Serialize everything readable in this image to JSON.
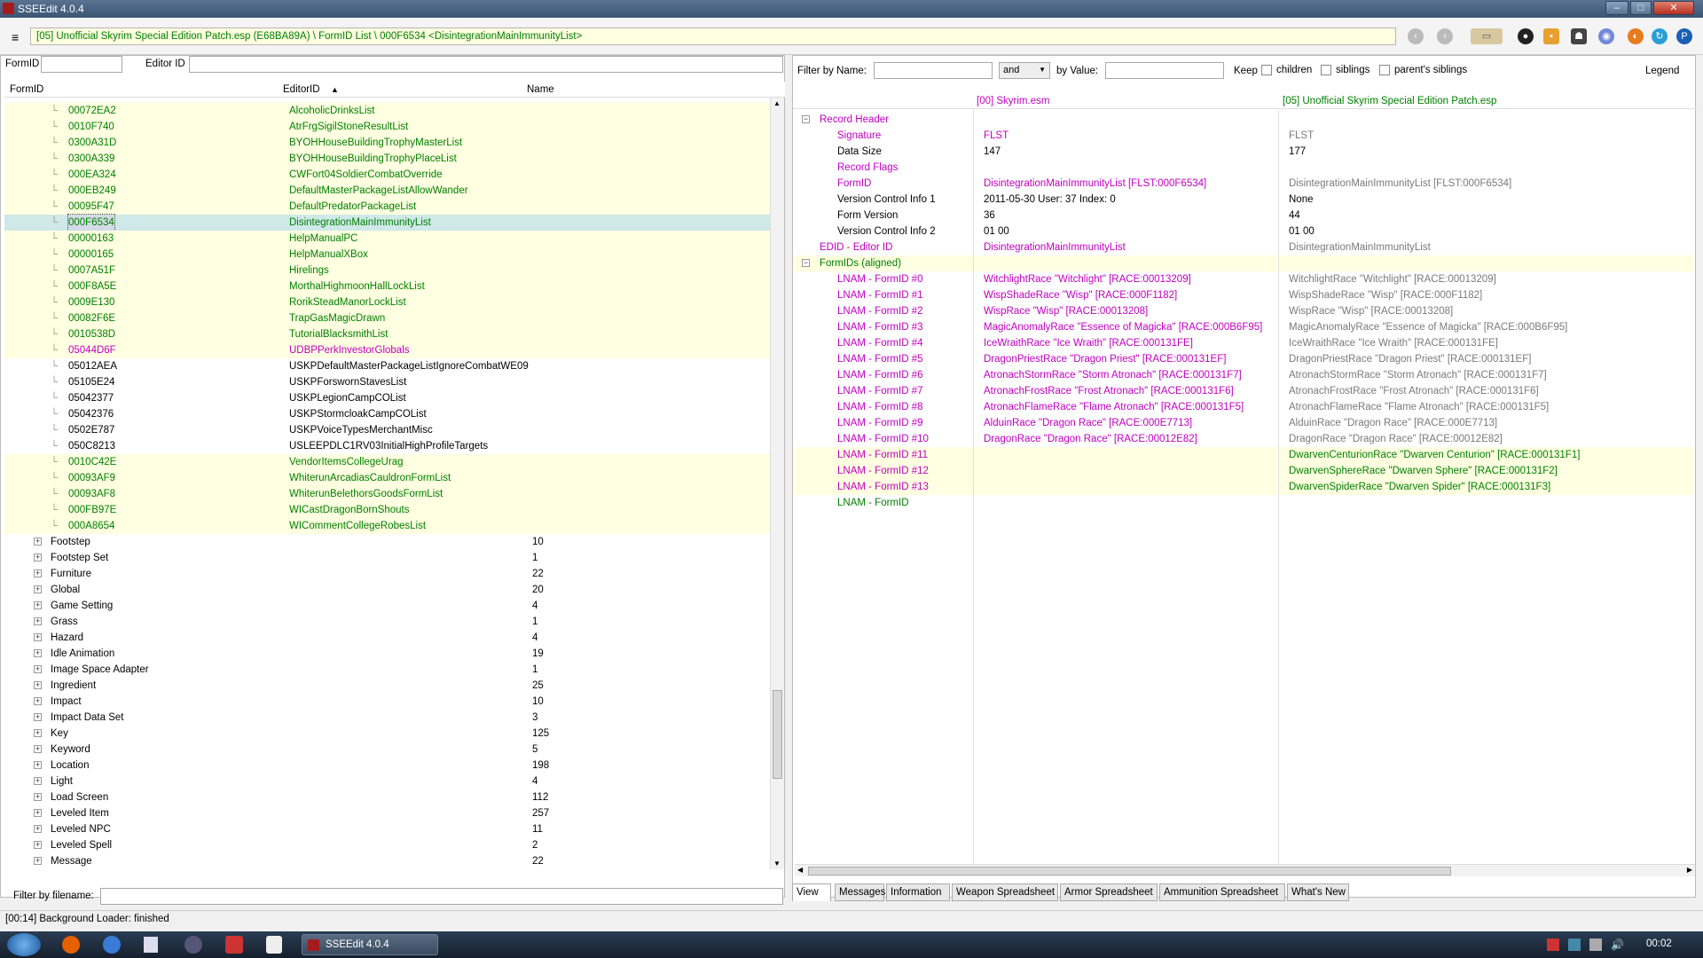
{
  "window": {
    "title": "SSEEdit 4.0.4"
  },
  "toolbar": {
    "path": "[05] Unofficial Skyrim Special Edition Patch.esp (E68BA89A) \\ FormID List \\ 000F6534 <DisintegrationMainImmunityList>"
  },
  "left": {
    "formid_label": "FormID",
    "editorid_label": "Editor ID",
    "headers": {
      "formid": "FormID",
      "editorid": "EditorID",
      "name": "Name"
    },
    "rows": [
      {
        "fid": "00072EA2",
        "eid": "AlcoholicDrinksList",
        "style": "g",
        "bg": "y"
      },
      {
        "fid": "0010F740",
        "eid": "AtrFrgSigilStoneResultList",
        "style": "g",
        "bg": "y"
      },
      {
        "fid": "0300A31D",
        "eid": "BYOHHouseBuildingTrophyMasterList",
        "style": "g",
        "bg": "y"
      },
      {
        "fid": "0300A339",
        "eid": "BYOHHouseBuildingTrophyPlaceList",
        "style": "g",
        "bg": "y"
      },
      {
        "fid": "000EA324",
        "eid": "CWFort04SoldierCombatOverride",
        "style": "g",
        "bg": "y"
      },
      {
        "fid": "000EB249",
        "eid": "DefaultMasterPackageListAllowWander",
        "style": "g",
        "bg": "y"
      },
      {
        "fid": "00095F47",
        "eid": "DefaultPredatorPackageList",
        "style": "g",
        "bg": "y"
      },
      {
        "fid": "000F6534",
        "eid": "DisintegrationMainImmunityList",
        "style": "g",
        "bg": "sel"
      },
      {
        "fid": "00000163",
        "eid": "HelpManualPC",
        "style": "g",
        "bg": "y"
      },
      {
        "fid": "00000165",
        "eid": "HelpManualXBox",
        "style": "g",
        "bg": "y"
      },
      {
        "fid": "0007A51F",
        "eid": "Hirelings",
        "style": "g",
        "bg": "y"
      },
      {
        "fid": "000F8A5E",
        "eid": "MorthalHighmoonHallLockList",
        "style": "g",
        "bg": "y"
      },
      {
        "fid": "0009E130",
        "eid": "RorikSteadManorLockList",
        "style": "g",
        "bg": "y"
      },
      {
        "fid": "00082F6E",
        "eid": "TrapGasMagicDrawn",
        "style": "g",
        "bg": "y"
      },
      {
        "fid": "0010538D",
        "eid": "TutorialBlacksmithList",
        "style": "g",
        "bg": "y"
      },
      {
        "fid": "05044D6F",
        "eid": "UDBPPerkInvestorGlobals",
        "style": "m",
        "bg": "y"
      },
      {
        "fid": "05012AEA",
        "eid": "USKPDefaultMasterPackageListIgnoreCombatWE09",
        "style": "",
        "bg": ""
      },
      {
        "fid": "05105E24",
        "eid": "USKPForswornStavesList",
        "style": "",
        "bg": ""
      },
      {
        "fid": "05042377",
        "eid": "USKPLegionCampCOList",
        "style": "",
        "bg": ""
      },
      {
        "fid": "05042376",
        "eid": "USKPStormcloakCampCOList",
        "style": "",
        "bg": ""
      },
      {
        "fid": "0502E787",
        "eid": "USKPVoiceTypesMerchantMisc",
        "style": "",
        "bg": ""
      },
      {
        "fid": "050C8213",
        "eid": "USLEEPDLC1RV03InitialHighProfileTargets",
        "style": "",
        "bg": ""
      },
      {
        "fid": "0010C42E",
        "eid": "VendorItemsCollegeUrag",
        "style": "g",
        "bg": "y"
      },
      {
        "fid": "00093AF9",
        "eid": "WhiterunArcadiasCauldronFormList",
        "style": "g",
        "bg": "y"
      },
      {
        "fid": "00093AF8",
        "eid": "WhiterunBelethorsGoodsFormList",
        "style": "g",
        "bg": "y"
      },
      {
        "fid": "000FB97E",
        "eid": "WICastDragonBornShouts",
        "style": "g",
        "bg": "y"
      },
      {
        "fid": "000A8654",
        "eid": "WICommentCollegeRobesList",
        "style": "g",
        "bg": "y"
      }
    ],
    "groups": [
      {
        "name": "Footstep",
        "count": "10"
      },
      {
        "name": "Footstep Set",
        "count": "1"
      },
      {
        "name": "Furniture",
        "count": "22"
      },
      {
        "name": "Global",
        "count": "20"
      },
      {
        "name": "Game Setting",
        "count": "4"
      },
      {
        "name": "Grass",
        "count": "1"
      },
      {
        "name": "Hazard",
        "count": "4"
      },
      {
        "name": "Idle Animation",
        "count": "19"
      },
      {
        "name": "Image Space Adapter",
        "count": "1"
      },
      {
        "name": "Ingredient",
        "count": "25"
      },
      {
        "name": "Impact",
        "count": "10"
      },
      {
        "name": "Impact Data Set",
        "count": "3"
      },
      {
        "name": "Key",
        "count": "125"
      },
      {
        "name": "Keyword",
        "count": "5"
      },
      {
        "name": "Location",
        "count": "198"
      },
      {
        "name": "Light",
        "count": "4"
      },
      {
        "name": "Load Screen",
        "count": "112"
      },
      {
        "name": "Leveled Item",
        "count": "257"
      },
      {
        "name": "Leveled NPC",
        "count": "11"
      },
      {
        "name": "Leveled Spell",
        "count": "2"
      },
      {
        "name": "Message",
        "count": "22"
      }
    ],
    "filter_filename_label": "Filter by filename:"
  },
  "right": {
    "filter_name_label": "Filter by Name:",
    "op_value": "and",
    "filter_value_label": "by Value:",
    "keep_label": "Keep",
    "children_label": "children",
    "siblings_label": "siblings",
    "parents_label": "parent's siblings",
    "legend_label": "Legend",
    "col1": "[00] Skyrim.esm",
    "col2": "[05] Unofficial Skyrim Special Edition Patch.esp",
    "rows": [
      {
        "k": "Record Header",
        "v1": "",
        "v2": "",
        "ind": 1,
        "kc": "m",
        "c1": "",
        "c2": "",
        "bg": "",
        "exp": true
      },
      {
        "k": "Signature",
        "v1": "FLST",
        "v2": "FLST",
        "ind": 2,
        "kc": "m",
        "c1": "m",
        "c2": "grey",
        "bg": ""
      },
      {
        "k": "Data Size",
        "v1": "147",
        "v2": "177",
        "ind": 2,
        "kc": "",
        "c1": "",
        "c2": "",
        "bg": ""
      },
      {
        "k": "Record Flags",
        "v1": "",
        "v2": "",
        "ind": 2,
        "kc": "m",
        "c1": "",
        "c2": "",
        "bg": ""
      },
      {
        "k": "FormID",
        "v1": "DisintegrationMainImmunityList [FLST:000F6534]",
        "v2": "DisintegrationMainImmunityList [FLST:000F6534]",
        "ind": 2,
        "kc": "m",
        "c1": "m",
        "c2": "grey",
        "bg": ""
      },
      {
        "k": "Version Control Info 1",
        "v1": "2011-05-30 User: 37 Index: 0",
        "v2": "None",
        "ind": 2,
        "kc": "",
        "c1": "",
        "c2": "",
        "bg": ""
      },
      {
        "k": "Form Version",
        "v1": "36",
        "v2": "44",
        "ind": 2,
        "kc": "",
        "c1": "",
        "c2": "",
        "bg": ""
      },
      {
        "k": "Version Control Info 2",
        "v1": "01 00",
        "v2": "01 00",
        "ind": 2,
        "kc": "",
        "c1": "",
        "c2": "",
        "bg": ""
      },
      {
        "k": "EDID - Editor ID",
        "v1": "DisintegrationMainImmunityList",
        "v2": "DisintegrationMainImmunityList",
        "ind": 1,
        "kc": "m",
        "c1": "m",
        "c2": "grey",
        "bg": ""
      },
      {
        "k": "FormIDs (aligned)",
        "v1": "",
        "v2": "",
        "ind": 1,
        "kc": "g",
        "c1": "",
        "c2": "",
        "bg": "y",
        "exp": true
      },
      {
        "k": "LNAM - FormID #0",
        "v1": "WitchlightRace \"Witchlight\" [RACE:00013209]",
        "v2": "WitchlightRace \"Witchlight\" [RACE:00013209]",
        "ind": 2,
        "kc": "m",
        "c1": "m",
        "c2": "grey",
        "bg": ""
      },
      {
        "k": "LNAM - FormID #1",
        "v1": "WispShadeRace \"Wisp\" [RACE:000F1182]",
        "v2": "WispShadeRace \"Wisp\" [RACE:000F1182]",
        "ind": 2,
        "kc": "m",
        "c1": "m",
        "c2": "grey",
        "bg": ""
      },
      {
        "k": "LNAM - FormID #2",
        "v1": "WispRace \"Wisp\" [RACE:00013208]",
        "v2": "WispRace \"Wisp\" [RACE:00013208]",
        "ind": 2,
        "kc": "m",
        "c1": "m",
        "c2": "grey",
        "bg": ""
      },
      {
        "k": "LNAM - FormID #3",
        "v1": "MagicAnomalyRace \"Essence of Magicka\" [RACE:000B6F95]",
        "v2": "MagicAnomalyRace \"Essence of Magicka\" [RACE:000B6F95]",
        "ind": 2,
        "kc": "m",
        "c1": "m",
        "c2": "grey",
        "bg": ""
      },
      {
        "k": "LNAM - FormID #4",
        "v1": "IceWraithRace \"Ice Wraith\" [RACE:000131FE]",
        "v2": "IceWraithRace \"Ice Wraith\" [RACE:000131FE]",
        "ind": 2,
        "kc": "m",
        "c1": "m",
        "c2": "grey",
        "bg": ""
      },
      {
        "k": "LNAM - FormID #5",
        "v1": "DragonPriestRace \"Dragon Priest\" [RACE:000131EF]",
        "v2": "DragonPriestRace \"Dragon Priest\" [RACE:000131EF]",
        "ind": 2,
        "kc": "m",
        "c1": "m",
        "c2": "grey",
        "bg": ""
      },
      {
        "k": "LNAM - FormID #6",
        "v1": "AtronachStormRace \"Storm Atronach\" [RACE:000131F7]",
        "v2": "AtronachStormRace \"Storm Atronach\" [RACE:000131F7]",
        "ind": 2,
        "kc": "m",
        "c1": "m",
        "c2": "grey",
        "bg": ""
      },
      {
        "k": "LNAM - FormID #7",
        "v1": "AtronachFrostRace \"Frost Atronach\" [RACE:000131F6]",
        "v2": "AtronachFrostRace \"Frost Atronach\" [RACE:000131F6]",
        "ind": 2,
        "kc": "m",
        "c1": "m",
        "c2": "grey",
        "bg": ""
      },
      {
        "k": "LNAM - FormID #8",
        "v1": "AtronachFlameRace \"Flame Atronach\" [RACE:000131F5]",
        "v2": "AtronachFlameRace \"Flame Atronach\" [RACE:000131F5]",
        "ind": 2,
        "kc": "m",
        "c1": "m",
        "c2": "grey",
        "bg": ""
      },
      {
        "k": "LNAM - FormID #9",
        "v1": "AlduinRace \"Dragon Race\" [RACE:000E7713]",
        "v2": "AlduinRace \"Dragon Race\" [RACE:000E7713]",
        "ind": 2,
        "kc": "m",
        "c1": "m",
        "c2": "grey",
        "bg": ""
      },
      {
        "k": "LNAM - FormID #10",
        "v1": "DragonRace \"Dragon Race\" [RACE:00012E82]",
        "v2": "DragonRace \"Dragon Race\" [RACE:00012E82]",
        "ind": 2,
        "kc": "m",
        "c1": "m",
        "c2": "grey",
        "bg": ""
      },
      {
        "k": "LNAM - FormID #11",
        "v1": "",
        "v2": "DwarvenCenturionRace \"Dwarven Centurion\" [RACE:000131F1]",
        "ind": 2,
        "kc": "m",
        "c1": "",
        "c2": "g",
        "bg": "y"
      },
      {
        "k": "LNAM - FormID #12",
        "v1": "",
        "v2": "DwarvenSphereRace \"Dwarven Sphere\" [RACE:000131F2]",
        "ind": 2,
        "kc": "m",
        "c1": "",
        "c2": "g",
        "bg": "y"
      },
      {
        "k": "LNAM - FormID #13",
        "v1": "",
        "v2": "DwarvenSpiderRace \"Dwarven Spider\" [RACE:000131F3]",
        "ind": 2,
        "kc": "m",
        "c1": "",
        "c2": "g",
        "bg": "y"
      },
      {
        "k": "LNAM - FormID",
        "v1": "",
        "v2": "",
        "ind": 2,
        "kc": "g",
        "c1": "",
        "c2": "",
        "bg": ""
      }
    ]
  },
  "tabs": [
    "View",
    "Messages",
    "Information",
    "Weapon Spreadsheet",
    "Armor Spreadsheet",
    "Ammunition Spreadsheet",
    "What's New"
  ],
  "status": "[00:14] Background Loader: finished",
  "taskbar": {
    "task": "SSEEdit 4.0.4",
    "clock": "00:02"
  },
  "icons": [
    "hamburger-icon",
    "back-icon",
    "forward-icon",
    "book-icon",
    "patreon-icon",
    "folder-icon",
    "nexus-icon",
    "discord-icon",
    "github-icon",
    "refresh-icon",
    "paypal-icon"
  ]
}
